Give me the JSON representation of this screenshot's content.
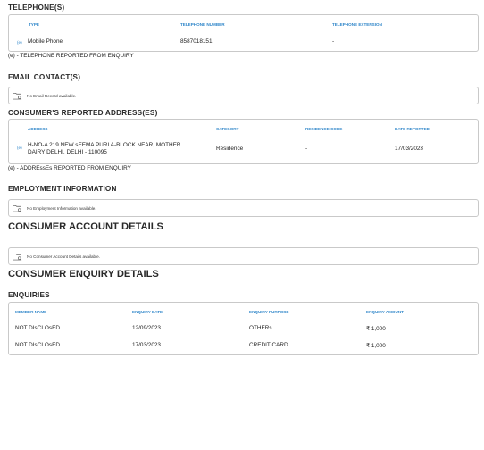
{
  "telephone": {
    "title": "TELEPHONE(S)",
    "headers": [
      "TYPE",
      "TELEPHONE NUMBER",
      "TELEPHONE EXTENSION"
    ],
    "row": {
      "tag": "(e)",
      "type": "Mobile Phone",
      "number": "8587018151",
      "extension": "-"
    },
    "note": "(e) - TELEPHONE REPORTED FROM ENQUIRY"
  },
  "email": {
    "title": "EMAIL CONTACT(S)",
    "empty": "No Email Record available."
  },
  "address": {
    "title": "CONSUMER'S REPORTED ADDRESS(ES)",
    "headers": [
      "ADDRESS",
      "CATEGORY",
      "RESIDENCE CODE",
      "DATE REPORTED"
    ],
    "row": {
      "tag": "(e)",
      "address_line1": "H-NO-A 219 NEW sEEMA PURI A-BLOCK NEAR, MOTHER",
      "address_line2": "DAIRY DELHI, DELHI - 110095",
      "category": "Residence",
      "residence_code": "-",
      "date": "17/03/2023"
    },
    "note": "(e) - ADDREssEs REPORTED FROM ENQUIRY"
  },
  "employment": {
    "title": "EMPLOYMENT INFORMATION",
    "empty": "No Employment Information available."
  },
  "account": {
    "title": "CONSUMER ACCOUNT DETAILS",
    "empty": "No Consumer Account Details available."
  },
  "enquiry_details": {
    "title": "CONSUMER ENQUIRY DETAILS"
  },
  "enquiries": {
    "title": "ENQUIRIES",
    "headers": [
      "MEMBER NAME",
      "ENQUIRY DATE",
      "ENQUIRY PURPOSE",
      "ENQUIRY AMOUNT"
    ],
    "rows": [
      {
        "member": "NOT DIsCLOsED",
        "date": "12/09/2023",
        "purpose": "OTHERs",
        "amount": "₹ 1,000"
      },
      {
        "member": "NOT DIsCLOsED",
        "date": "17/03/2023",
        "purpose": "CREDIT CARD",
        "amount": "₹ 1,000"
      }
    ]
  },
  "colors": {
    "header_blue": "#2f86c9",
    "border": "#c9c9c9"
  },
  "icons": {
    "empty_state": "folder-search-icon"
  }
}
